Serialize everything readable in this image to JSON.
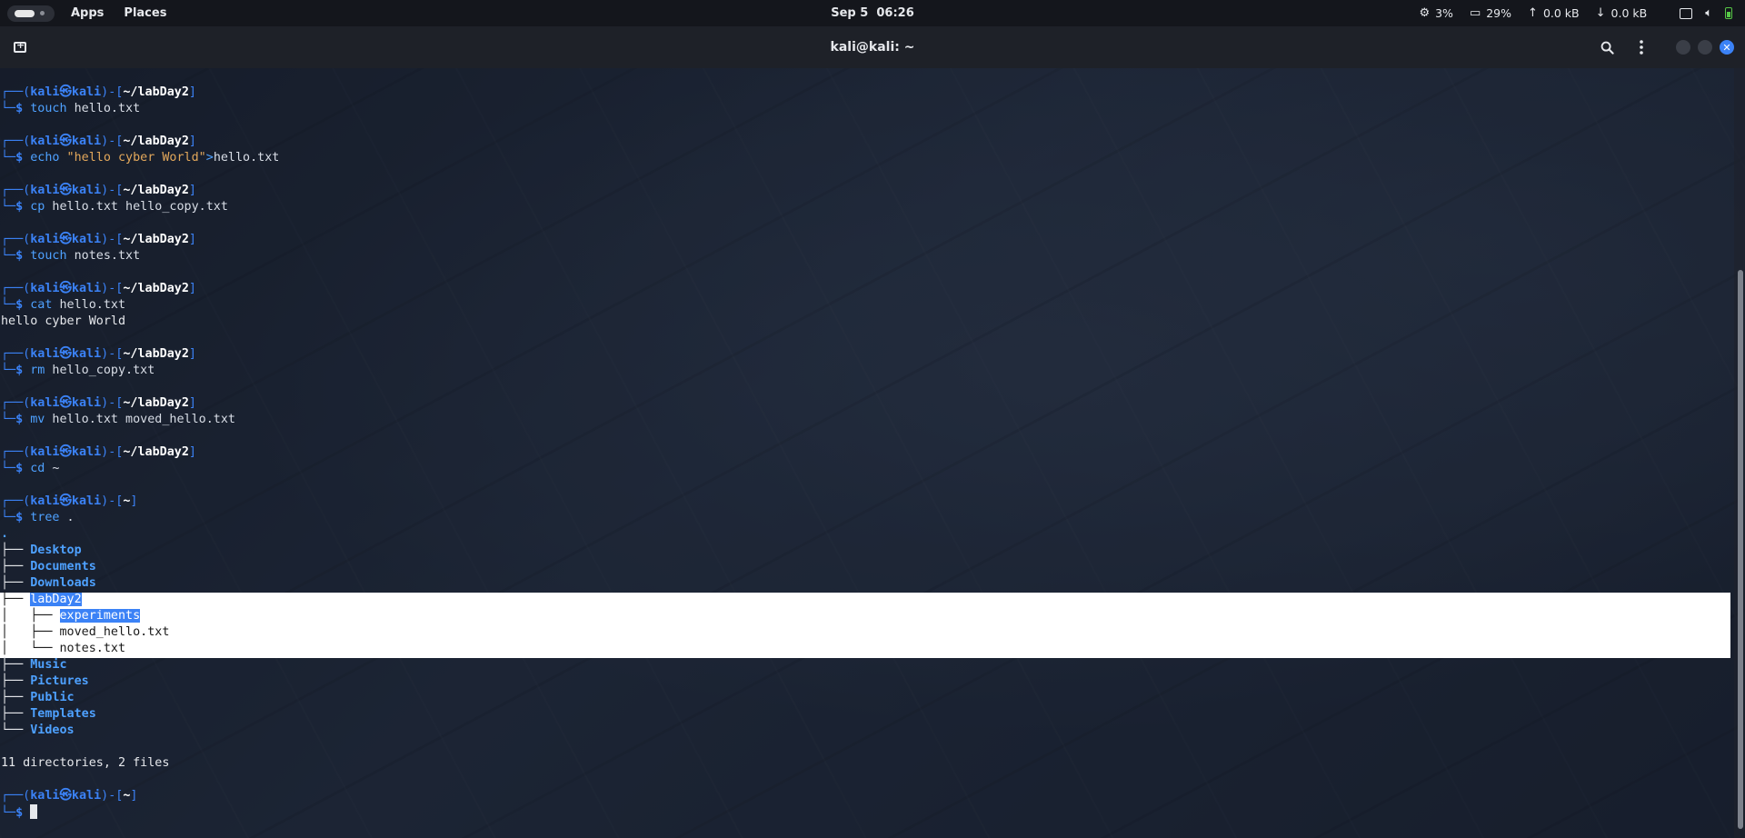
{
  "top_panel": {
    "apps_label": "Apps",
    "places_label": "Places",
    "clock": "Sep 5  06:26",
    "cpu": "3%",
    "memory": "29%",
    "net_up": "0.0 kB",
    "net_down": "0.0 kB"
  },
  "window": {
    "title": "kali@kali: ~"
  },
  "prompt": {
    "open": "┌──(",
    "user": "kali",
    "at": "㉿",
    "host": "kali",
    "mid": ")-[",
    "close": "]",
    "dollar_prefix": "└─",
    "dollar": "$"
  },
  "session": [
    {
      "path": "~/labDay2",
      "cmd": "touch",
      "args": " hello.txt",
      "output": []
    },
    {
      "path": "~/labDay2",
      "cmd": "echo",
      "string": " \"hello cyber World\"",
      "redir": ">",
      "args": "hello.txt",
      "output": []
    },
    {
      "path": "~/labDay2",
      "cmd": "cp",
      "args": " hello.txt hello_copy.txt",
      "output": []
    },
    {
      "path": "~/labDay2",
      "cmd": "touch",
      "args": " notes.txt",
      "output": []
    },
    {
      "path": "~/labDay2",
      "cmd": "cat",
      "args": " hello.txt",
      "output": [
        "hello cyber World"
      ]
    },
    {
      "path": "~/labDay2",
      "cmd": "rm",
      "args": " hello_copy.txt",
      "output": []
    },
    {
      "path": "~/labDay2",
      "cmd": "mv",
      "args": " hello.txt moved_hello.txt",
      "output": []
    },
    {
      "path": "~/labDay2",
      "cmd": "cd",
      "args": " ~",
      "output": []
    },
    {
      "path": "~",
      "cmd": "tree",
      "args": " .",
      "output": []
    }
  ],
  "tree": {
    "root": ".",
    "entries_before": [
      "Desktop",
      "Documents",
      "Downloads"
    ],
    "labday2": "labDay2",
    "labday2_children": [
      {
        "branch": "├── ",
        "name": "experiments",
        "selected": true
      },
      {
        "branch": "├── ",
        "name": "moved_hello.txt",
        "selected": false
      },
      {
        "branch": "└── ",
        "name": "notes.txt",
        "selected": false
      }
    ],
    "entries_after": [
      "Music",
      "Pictures",
      "Public",
      "Templates",
      "Videos"
    ],
    "summary": "11 directories, 2 files"
  },
  "final_prompt_path": "~",
  "colors": {
    "accent": "#3b82f6",
    "string": "#e3a85b",
    "selection_bg": "#ffffff"
  }
}
